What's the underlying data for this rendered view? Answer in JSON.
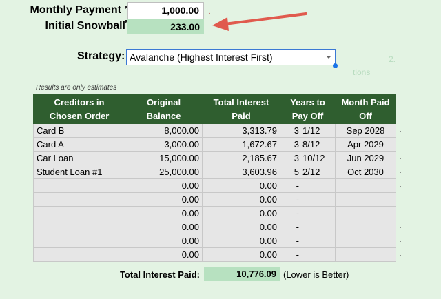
{
  "inputs": {
    "monthly_payment_label": "Monthly Payment",
    "monthly_payment_value": "1,000.00",
    "initial_snowball_label": "Initial Snowball",
    "initial_snowball_value": "233.00"
  },
  "strategy": {
    "label": "Strategy:",
    "selected": "Avalanche (Highest Interest First)"
  },
  "note": "Results are only estimates",
  "table": {
    "headers": [
      [
        "Creditors in",
        "Chosen Order"
      ],
      [
        "Original",
        "Balance"
      ],
      [
        "Total Interest",
        "Paid"
      ],
      [
        "Years to",
        "Pay Off"
      ],
      [
        "Month Paid",
        "Off"
      ]
    ],
    "rows": [
      {
        "name": "Card B",
        "balance": "8,000.00",
        "interest": "3,313.79",
        "years": "3",
        "months": "1/12",
        "paid_off": "Sep 2028"
      },
      {
        "name": "Card A",
        "balance": "3,000.00",
        "interest": "1,672.67",
        "years": "3",
        "months": "8/12",
        "paid_off": "Apr 2029"
      },
      {
        "name": "Car Loan",
        "balance": "15,000.00",
        "interest": "2,185.67",
        "years": "3",
        "months": "10/12",
        "paid_off": "Jun 2029"
      },
      {
        "name": "Student Loan #1",
        "balance": "25,000.00",
        "interest": "3,603.96",
        "years": "5",
        "months": "2/12",
        "paid_off": "Oct 2030"
      },
      {
        "name": "",
        "balance": "0.00",
        "interest": "0.00",
        "years": "-",
        "months": "",
        "paid_off": ""
      },
      {
        "name": "",
        "balance": "0.00",
        "interest": "0.00",
        "years": "-",
        "months": "",
        "paid_off": ""
      },
      {
        "name": "",
        "balance": "0.00",
        "interest": "0.00",
        "years": "-",
        "months": "",
        "paid_off": ""
      },
      {
        "name": "",
        "balance": "0.00",
        "interest": "0.00",
        "years": "-",
        "months": "",
        "paid_off": ""
      },
      {
        "name": "",
        "balance": "0.00",
        "interest": "0.00",
        "years": "-",
        "months": "",
        "paid_off": ""
      },
      {
        "name": "",
        "balance": "0.00",
        "interest": "0.00",
        "years": "-",
        "months": "",
        "paid_off": ""
      }
    ]
  },
  "total": {
    "label": "Total Interest Paid:",
    "value": "10,776.09",
    "note": "(Lower is Better)"
  },
  "faint_text": {
    "number": "2.",
    "word": "tions"
  },
  "colors": {
    "header_bg": "#2f5e2f",
    "highlight": "#b7e1c0",
    "arrow": "#e05a4e",
    "background": "#e3f3e3"
  },
  "icons": {
    "arrow": "red-arrow-icon",
    "dropdown": "dropdown-arrow-icon"
  }
}
